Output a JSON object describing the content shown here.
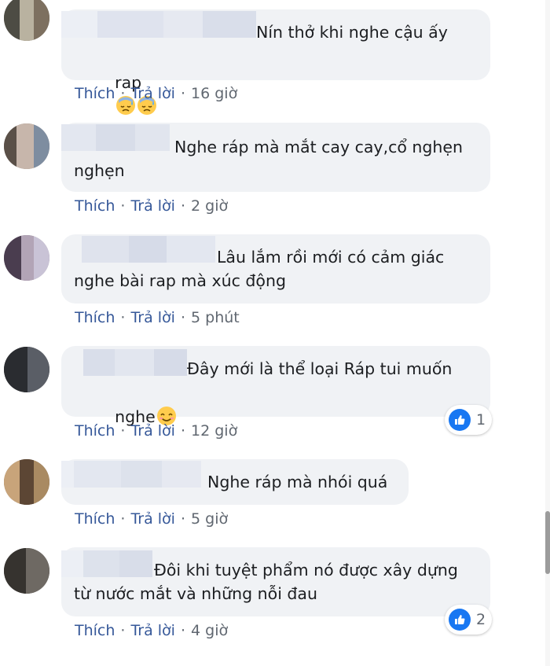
{
  "actions": {
    "like": "Thích",
    "reply": "Trả lời"
  },
  "comments": [
    {
      "text": "Nín thở khi nghe cậu ấy",
      "text2": "rap",
      "time": "16 giờ",
      "emojis": [
        "downcast-sweat-emoji",
        "downcast-sweat-emoji"
      ],
      "reactions": null
    },
    {
      "text": "Nghe ráp mà mắt cay cay,cổ nghẹn",
      "text2": "nghẹn",
      "time": "2 giờ",
      "reactions": null
    },
    {
      "text": "Lâu lắm rồi mới có cảm giác",
      "text2": "nghe bài rap mà xúc động",
      "time": "5 phút",
      "reactions": null
    },
    {
      "text": "Đây mới là thể loại Ráp tui muốn",
      "text2": "nghe",
      "time": "12 giờ",
      "emojis": [
        "smiling-emoji"
      ],
      "reactions": {
        "icon": "like-icon",
        "count": "1"
      }
    },
    {
      "text": "Nghe ráp mà nhói quá",
      "text2": "",
      "time": "5 giờ",
      "reactions": null
    },
    {
      "text": "Đôi khi tuyệt phẩm nó được xây dựng",
      "text2": "từ nước mắt và những nỗi đau",
      "time": "4 giờ",
      "reactions": {
        "icon": "like-icon",
        "count": "2"
      }
    }
  ],
  "colors": {
    "bubble": "#f0f2f5",
    "link": "#365899",
    "meta": "#606770",
    "like_blue": "#1877f2",
    "redaction": "#dde2ee"
  }
}
